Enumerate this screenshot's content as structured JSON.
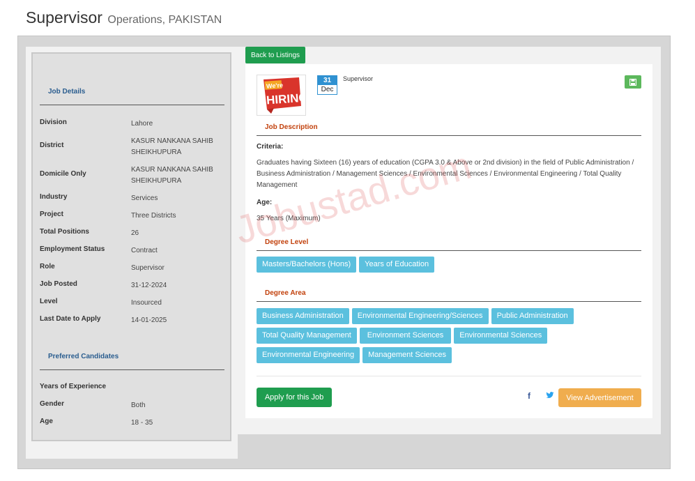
{
  "header": {
    "title": "Supervisor",
    "subtitle": "Operations, PAKISTAN"
  },
  "back_button": {
    "label": "Back to Listings"
  },
  "sidebar": {
    "job_details_title": "Job Details",
    "details": [
      {
        "label": "Division",
        "value": "Lahore"
      },
      {
        "label": "District",
        "value": "KASUR NANKANA SAHIB SHEIKHUPURA"
      },
      {
        "label": "Domicile Only",
        "value": "KASUR NANKANA SAHIB SHEIKHUPURA"
      },
      {
        "label": "Industry",
        "value": "Services"
      },
      {
        "label": "Project",
        "value": "Three Districts"
      },
      {
        "label": "Total Positions",
        "value": "26"
      },
      {
        "label": "Employment Status",
        "value": "Contract"
      },
      {
        "label": "Role",
        "value": "Supervisor"
      },
      {
        "label": "Job Posted",
        "value": "31-12-2024"
      },
      {
        "label": "Level",
        "value": "Insourced"
      },
      {
        "label": "Last Date to Apply",
        "value": "14-01-2025"
      }
    ],
    "preferred_title": "Preferred Candidates",
    "preferred": [
      {
        "label": "Years of Experience",
        "value": ""
      },
      {
        "label": "Gender",
        "value": "Both"
      },
      {
        "label": "Age",
        "value": "18 - 35"
      }
    ]
  },
  "job_card": {
    "logo_text_top": "We're",
    "logo_text_main": "HIRING",
    "date_day": "31",
    "date_month": "Dec",
    "job_title": "Supervisor"
  },
  "description": {
    "title": "Job Description",
    "criteria_label": "Criteria:",
    "criteria_text": "Graduates having Sixteen (16) years of education (CGPA 3.0 & Above or 2nd division) in the field of Public Administration / Business Administration / Management Sciences / Environmental Sciences / Environmental Engineering / Total Quality Management",
    "age_label": "Age:",
    "age_text": "35 Years (Maximum)"
  },
  "degree_level": {
    "title": "Degree Level",
    "items": [
      "Masters/Bachelors (Hons)",
      "Years of Education"
    ]
  },
  "degree_area": {
    "title": "Degree Area",
    "items": [
      "Business Administration",
      "Environmental Engineering/Sciences",
      "Public Administration",
      "Total Quality Management",
      "Environment Sciences",
      "Environmental Sciences",
      "Environmental Engineering",
      "Management Sciences"
    ]
  },
  "actions": {
    "apply_label": "Apply for this Job",
    "facebook_glyph": "f",
    "advert_label": "View Advertisement"
  },
  "watermark": "Jobustad.com",
  "colors": {
    "green": "#1f9d4f",
    "chip": "#5bc0de",
    "orange": "#f0ad4e",
    "section_orange": "#c2410c",
    "section_blue": "#2a5d8f"
  }
}
